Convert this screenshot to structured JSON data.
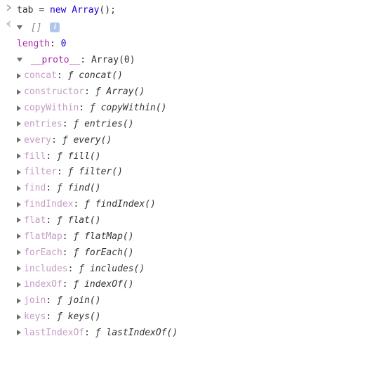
{
  "input": {
    "var_name": "tab",
    "assign_op": "=",
    "keyword_new": "new",
    "class_name": "Array",
    "call_suffix": "();"
  },
  "output": {
    "preview": "[]",
    "info_glyph": "i",
    "length_key": "length",
    "length_value": "0",
    "proto_key": "__proto__",
    "proto_value": "Array(0)",
    "methods": [
      {
        "name": "concat",
        "sig": "concat()"
      },
      {
        "name": "constructor",
        "sig": "Array()"
      },
      {
        "name": "copyWithin",
        "sig": "copyWithin()"
      },
      {
        "name": "entries",
        "sig": "entries()"
      },
      {
        "name": "every",
        "sig": "every()"
      },
      {
        "name": "fill",
        "sig": "fill()"
      },
      {
        "name": "filter",
        "sig": "filter()"
      },
      {
        "name": "find",
        "sig": "find()"
      },
      {
        "name": "findIndex",
        "sig": "findIndex()"
      },
      {
        "name": "flat",
        "sig": "flat()"
      },
      {
        "name": "flatMap",
        "sig": "flatMap()"
      },
      {
        "name": "forEach",
        "sig": "forEach()"
      },
      {
        "name": "includes",
        "sig": "includes()"
      },
      {
        "name": "indexOf",
        "sig": "indexOf()"
      },
      {
        "name": "join",
        "sig": "join()"
      },
      {
        "name": "keys",
        "sig": "keys()"
      },
      {
        "name": "lastIndexOf",
        "sig": "lastIndexOf()"
      }
    ]
  }
}
